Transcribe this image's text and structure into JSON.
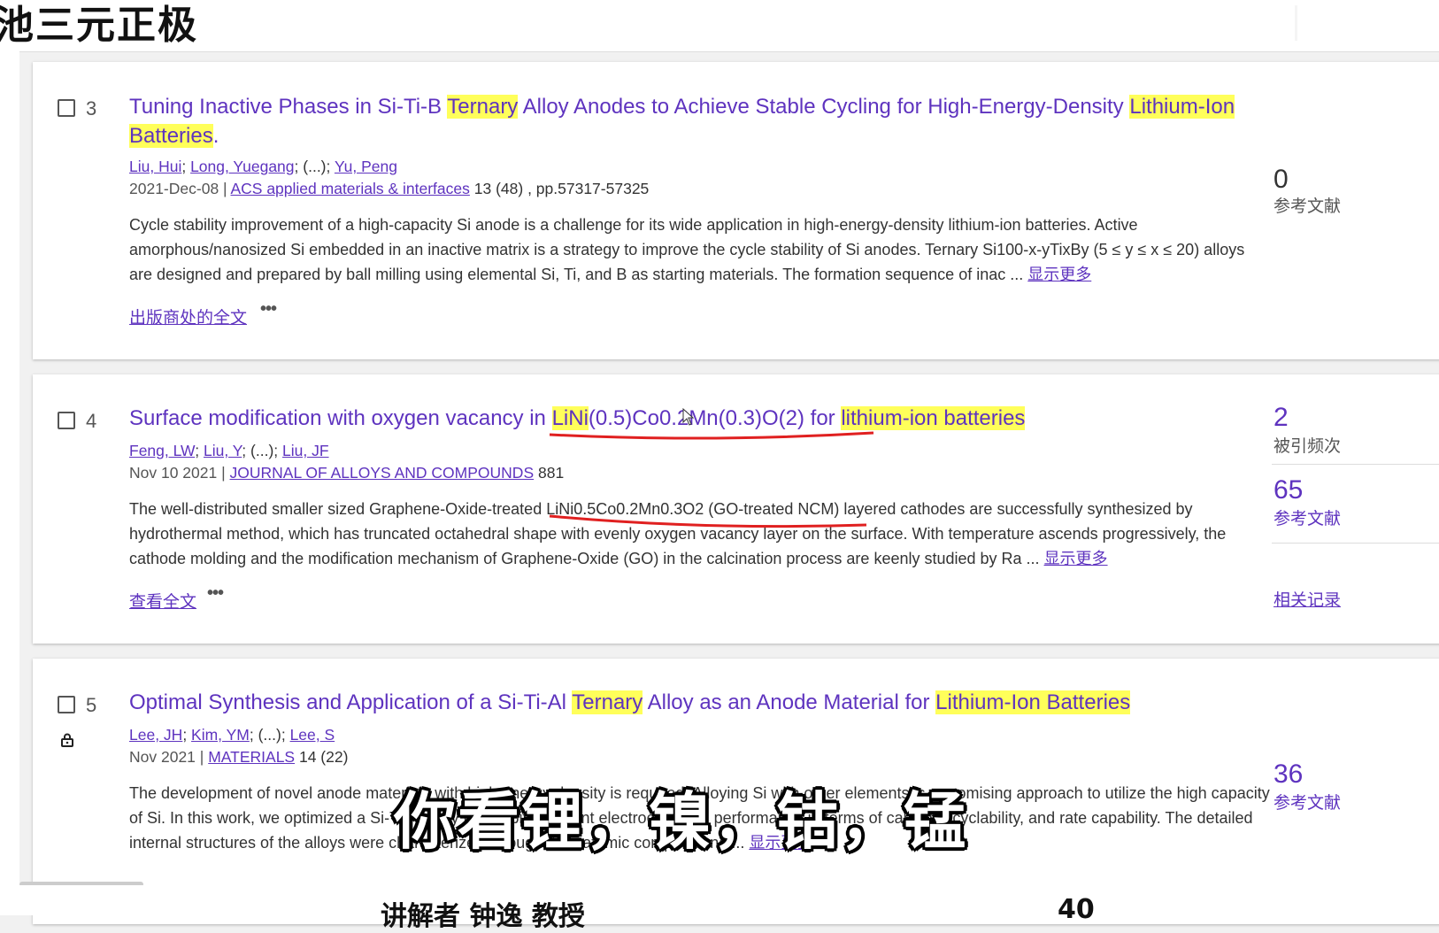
{
  "header": {
    "title_fragment": "池三元正极"
  },
  "records": [
    {
      "index": "3",
      "title_parts": [
        {
          "text": "Tuning Inactive Phases in Si-Ti-B ",
          "hl": false
        },
        {
          "text": "Ternary",
          "hl": true
        },
        {
          "text": " Alloy Anodes to Achieve Stable Cycling for High-Energy-Density ",
          "hl": false
        },
        {
          "text": "Lithium-Ion Batteries",
          "hl": true
        },
        {
          "text": ".",
          "hl": false
        }
      ],
      "authors": [
        "Liu, Hui",
        "Long, Yuegang",
        "(...)",
        "Yu, Peng"
      ],
      "date": "2021-Dec-08",
      "journal": "ACS applied materials & interfaces",
      "volume": "13 (48) , pp.57317-57325",
      "abstract": "Cycle stability improvement of a high-capacity Si anode is a challenge for its wide application in high-energy-density lithium-ion batteries. Active amorphous/nanosized Si embedded in an inactive matrix is a strategy to improve the cycle stability of Si anodes. Ternary Si100-x-yTixBy (5 ≤ y ≤ x ≤ 20) alloys are designed and prepared by ball milling using elemental Si, Ti, and B as starting materials. The formation sequence of inac ...",
      "show_more": "显示更多",
      "fulltext_link": "出版商处的全文",
      "metrics": [
        {
          "value": "0",
          "label": "参考文献"
        }
      ]
    },
    {
      "index": "4",
      "title_parts": [
        {
          "text": "Surface modification with oxygen vacancy in ",
          "hl": false
        },
        {
          "text": "LiNi",
          "hl": true
        },
        {
          "text": "(0.5)Co0.2Mn(0.3)O(2) for ",
          "hl": false
        },
        {
          "text": "lithium-ion batteries",
          "hl": true
        }
      ],
      "authors": [
        "Feng, LW",
        "Liu, Y",
        "(...)",
        "Liu, JF"
      ],
      "date": "Nov 10 2021",
      "journal": "JOURNAL OF ALLOYS AND COMPOUNDS",
      "volume": "881",
      "abstract": "The well-distributed smaller sized Graphene-Oxide-treated LiNi0.5Co0.2Mn0.3O2 (GO-treated NCM) layered cathodes are successfully synthesized by hydrothermal method, which has truncated octahedral shape with evenly oxygen vacancy layer on the surface. With temperature ascends progressively, the cathode molding and the modification mechanism of Graphene-Oxide (GO) in the calcination process are keenly studied by Ra ...",
      "show_more": "显示更多",
      "fulltext_link": "查看全文",
      "metrics": [
        {
          "value": "2",
          "label": "被引频次"
        },
        {
          "value": "65",
          "label": "参考文献"
        }
      ],
      "related_link": "相关记录"
    },
    {
      "index": "5",
      "title_parts": [
        {
          "text": "Optimal Synthesis and Application of a Si-Ti-Al ",
          "hl": false
        },
        {
          "text": "Ternary",
          "hl": true
        },
        {
          "text": " Alloy as an Anode Material for ",
          "hl": false
        },
        {
          "text": "Lithium-Ion Batteries",
          "hl": true
        }
      ],
      "authors": [
        "Lee, JH",
        "Kim, YM",
        "(...)",
        "Lee, S"
      ],
      "date": "Nov 2021",
      "journal": "MATERIALS",
      "volume": "14 (22)",
      "abstract": "The development of novel anode materials with high energy density is required. Alloying Si with other elements is a promising approach to utilize the high capacity of Si. In this work, we optimized a Si-Ti-Al alloy to exhibit excellent electrochemical performance in terms of capacity, cyclability, and rate capability. The detailed internal structures of the alloys were characterized through their atomic compositions ...",
      "show_more": "显示更多",
      "metrics": [
        {
          "value": "36",
          "label": "参考文献"
        }
      ]
    }
  ],
  "subtitle": "你看锂，镍，钴，锰",
  "bottom": {
    "left": "讲解者 钟逸 教授",
    "right": "40"
  },
  "colors": {
    "link": "#5e33bf",
    "highlight": "#ffff5a",
    "annotation": "#e02020"
  }
}
